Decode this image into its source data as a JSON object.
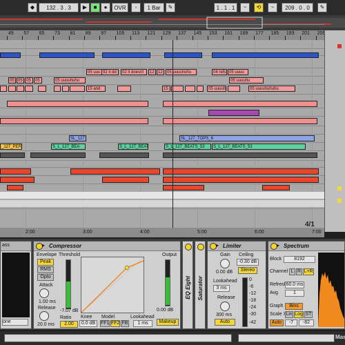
{
  "transport": {
    "tempo": "132 .   3 .   3",
    "ovr": "OVR",
    "quantize": "1 Bar",
    "position": "1 .   1 .   1",
    "loop_length": "209 .   0 .   0"
  },
  "ruler": {
    "bars": [
      "49",
      "57",
      "65",
      "73",
      "81",
      "89",
      "97",
      "105",
      "113",
      "121",
      "129",
      "137",
      "145",
      "153",
      "161",
      "169",
      "177",
      "185",
      "193",
      "201",
      "209"
    ],
    "times": [
      "2:00",
      "3:00",
      "4:00",
      "5:00",
      "6:00",
      "7:00"
    ]
  },
  "clips": {
    "c1": "05 uuu",
    "c2": "92 it dd",
    "c3": "02 it doesnt",
    "c4": "12",
    "c5": "12",
    "c6": "05 uuuuhuhu",
    "c7": "04 refs",
    "c8": "05 uuuu",
    "c9": "05",
    "c10": "05",
    "c11": "05",
    "c12": "05",
    "c13": "05 uuuuhuhu",
    "c14": "15 and",
    "c15": "15 ar",
    "c16": "05 uuuuhu",
    "c17": "05 uuuuhu",
    "c18": "05 uuuuhuhuhu",
    "sl127": "SL_127",
    "sltops": "SL_127_TOPS_6",
    "perc": "_127_PERC",
    "b1": "S_L_127_BEA",
    "b2": "S_L_127_BEAT",
    "b3": "S_L_127_BEATS_53",
    "b4": "S_L_127_BEATS_53"
  },
  "view_zoom": "4/1",
  "compressor": {
    "title": "Compressor",
    "envelope": "Envelope",
    "peak": "Peak",
    "rms": "RMS",
    "opto": "Opto",
    "threshold": "Threshold",
    "threshold_val": "-7.07 dB",
    "ratio": "Ratio",
    "ratio_val": "2.00",
    "attack": "Attack",
    "attack_val": "1.00 ms",
    "release": "Release",
    "release_val": "20.0 ms",
    "knee": "Knee",
    "knee_val": "0.0 dB",
    "model": "Model",
    "ff1": "FF1",
    "ff2": "FF2",
    "fb": "FB",
    "lookahead": "Lookahead",
    "lookahead_val": "1 ms",
    "output": "Output",
    "output_val": "0.00 dB",
    "makeup": "Makeup"
  },
  "eq_title": "EQ Eight",
  "saturator_title": "Saturator",
  "limiter": {
    "title": "Limiter",
    "gain": "Gain",
    "gain_val": "0.00 dB",
    "ceiling": "Ceiling",
    "ceiling_val": "-0.30 dB",
    "stereo": "Stereo",
    "lookahead": "Lookahead",
    "lookahead_val": "3 ms",
    "release": "Release",
    "release_val": "300 ms",
    "auto": "Auto",
    "scale": [
      "0",
      "-6",
      "-12",
      "-18",
      "-24",
      "-30",
      "-42"
    ]
  },
  "spectrum": {
    "title": "Spectrum",
    "block": "Block",
    "block_val": "8192",
    "channel": "Channel",
    "ch_l": "L",
    "ch_r": "R",
    "ch_lr": "L+R",
    "refresh": "Refresh",
    "refresh_val": "60.0 ms",
    "avg": "Avg",
    "avg_val": "1",
    "graph": "Graph",
    "bins": "Bins",
    "scale_x": "Scale X",
    "lin": "Lin",
    "log": "Log",
    "st": "ST",
    "auto": "Auto",
    "range_lo": "-7",
    "range_hi": "-82"
  },
  "left_device": {
    "label": "ass",
    "dropdown": "one"
  },
  "status": {
    "right_label": "Mast"
  }
}
